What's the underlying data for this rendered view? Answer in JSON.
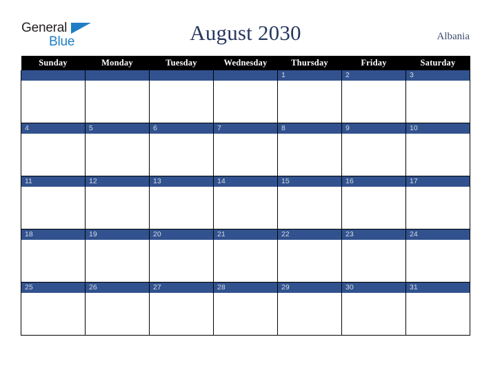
{
  "brand": {
    "logo_text_1": "General",
    "logo_text_2": "Blue",
    "logo_triangle_icon": "triangle-icon",
    "color_dark": "#231f20",
    "color_blue": "#1f7ec4"
  },
  "header": {
    "title": "August 2030",
    "country": "Albania",
    "title_color": "#27375e"
  },
  "calendar": {
    "month": "August",
    "year": "2030",
    "accent_color": "#31528e",
    "header_bg": "#000000",
    "header_text_color": "#ffffff",
    "weekday_headers": [
      "Sunday",
      "Monday",
      "Tuesday",
      "Wednesday",
      "Thursday",
      "Friday",
      "Saturday"
    ],
    "weeks": [
      [
        {
          "day": ""
        },
        {
          "day": ""
        },
        {
          "day": ""
        },
        {
          "day": ""
        },
        {
          "day": "1"
        },
        {
          "day": "2"
        },
        {
          "day": "3"
        }
      ],
      [
        {
          "day": "4"
        },
        {
          "day": "5"
        },
        {
          "day": "6"
        },
        {
          "day": "7"
        },
        {
          "day": "8"
        },
        {
          "day": "9"
        },
        {
          "day": "10"
        }
      ],
      [
        {
          "day": "11"
        },
        {
          "day": "12"
        },
        {
          "day": "13"
        },
        {
          "day": "14"
        },
        {
          "day": "15"
        },
        {
          "day": "16"
        },
        {
          "day": "17"
        }
      ],
      [
        {
          "day": "18"
        },
        {
          "day": "19"
        },
        {
          "day": "20"
        },
        {
          "day": "21"
        },
        {
          "day": "22"
        },
        {
          "day": "23"
        },
        {
          "day": "24"
        }
      ],
      [
        {
          "day": "25"
        },
        {
          "day": "26"
        },
        {
          "day": "27"
        },
        {
          "day": "28"
        },
        {
          "day": "29"
        },
        {
          "day": "30"
        },
        {
          "day": "31"
        }
      ]
    ]
  }
}
